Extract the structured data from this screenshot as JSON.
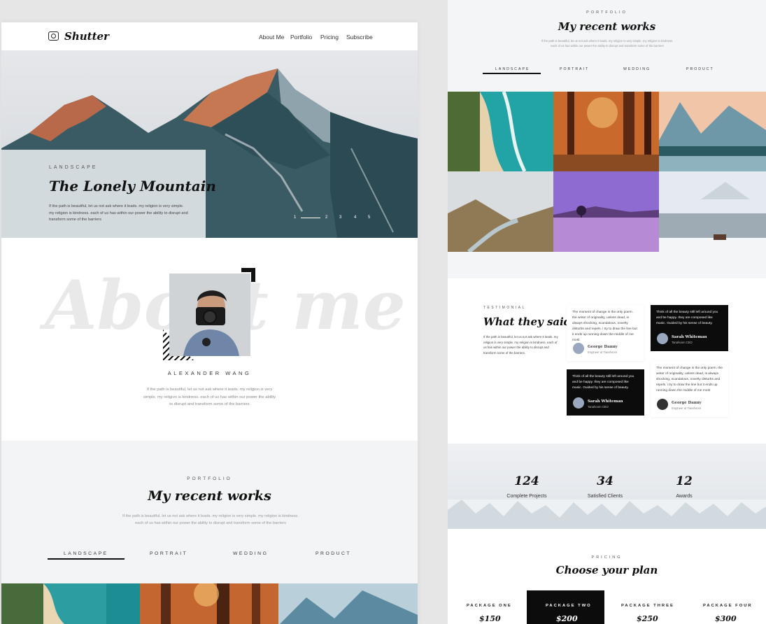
{
  "nav": {
    "logo": "Shutter",
    "links": [
      "About Me",
      "Portfolio",
      "Pricing",
      "Subscribe"
    ]
  },
  "hero": {
    "eyebrow": "LANDSCAPE",
    "title": "The Lonely Mountain",
    "description": "If the path is beautiful, let us not ask where it leads. my religion is very simple. my religion is kindness. each of us has within our power the ability to disrupt and transform some of the barriers",
    "slides": [
      "1",
      "2",
      "3",
      "4",
      "5"
    ]
  },
  "about": {
    "background_text": "About me",
    "name": "ALEXANDER WANG",
    "description": "If the path is beautiful, let us not ask where it leads. my religion is very simple. my religion is kindness. each of us has within our power the ability to disrupt and transform some of the barriers"
  },
  "portfolio": {
    "eyebrow": "PORTFOLIO",
    "title": "My recent works",
    "description": "If the path is beautiful, let us not ask where it leads. my religion is very simple. my religion is kindness. each of us has within our power the ability to disrupt and transform some of the barriers",
    "tabs": [
      "LANDSCAPE",
      "PORTRAIT",
      "WEDDING",
      "PRODUCT"
    ],
    "active_tab": "LANDSCAPE"
  },
  "testimonial": {
    "eyebrow": "TESTIMONIAL",
    "title": "What they said",
    "description": "If the path is beautiful, let us not ask where it leads. my religion is very simple. my religion is kindness. each of us has within our power the ability to disrupt and transform some of the barriers.",
    "cards": [
      {
        "quote": "The moment of change is the only poem. the writer of originality, unless dead, is always shocking, scandalous, novelty disturbs and repels. i try to draw the line but it ends up running down the middle of me most",
        "name": "George Danny",
        "role": "Engineer at Tanahoom",
        "theme": "light"
      },
      {
        "quote": "Think of all the beauty still left around you and be happy. they are composed like music. Guided by his sense of beauty.",
        "name": "Sarah Whiteman",
        "role": "Tanahoom CEO",
        "theme": "dark"
      },
      {
        "quote": "Think of all the beauty still left around you and be happy. they are composed like music. Guided by his sense of beauty.",
        "name": "Sarah Whiteman",
        "role": "Tanahoom CEO",
        "theme": "dark"
      },
      {
        "quote": "The moment of change is the only poem. the writer of originality, unless dead, is always shocking, scandalous, novelty disturbs and repels. i try to draw the line but it ends up running down the middle of me most",
        "name": "George Danny",
        "role": "Engineer at Tanahoom",
        "theme": "light"
      }
    ]
  },
  "stats": [
    {
      "value": "124",
      "label": "Complete Projects"
    },
    {
      "value": "34",
      "label": "Satisfied Clients"
    },
    {
      "value": "12",
      "label": "Awards"
    }
  ],
  "pricing": {
    "eyebrow": "PRICING",
    "title": "Choose your plan",
    "packages": [
      {
        "name": "PACKAGE ONE",
        "price": "$150",
        "highlight": false
      },
      {
        "name": "PACKAGE TWO",
        "price": "$200",
        "highlight": true
      },
      {
        "name": "PACKAGE THREE",
        "price": "$250",
        "highlight": false
      },
      {
        "name": "PACKAGE FOUR",
        "price": "$300",
        "highlight": false
      }
    ]
  },
  "colors": {
    "accent": "#111111",
    "background": "#f4f5f6",
    "card_dark": "#0c0c0c"
  }
}
